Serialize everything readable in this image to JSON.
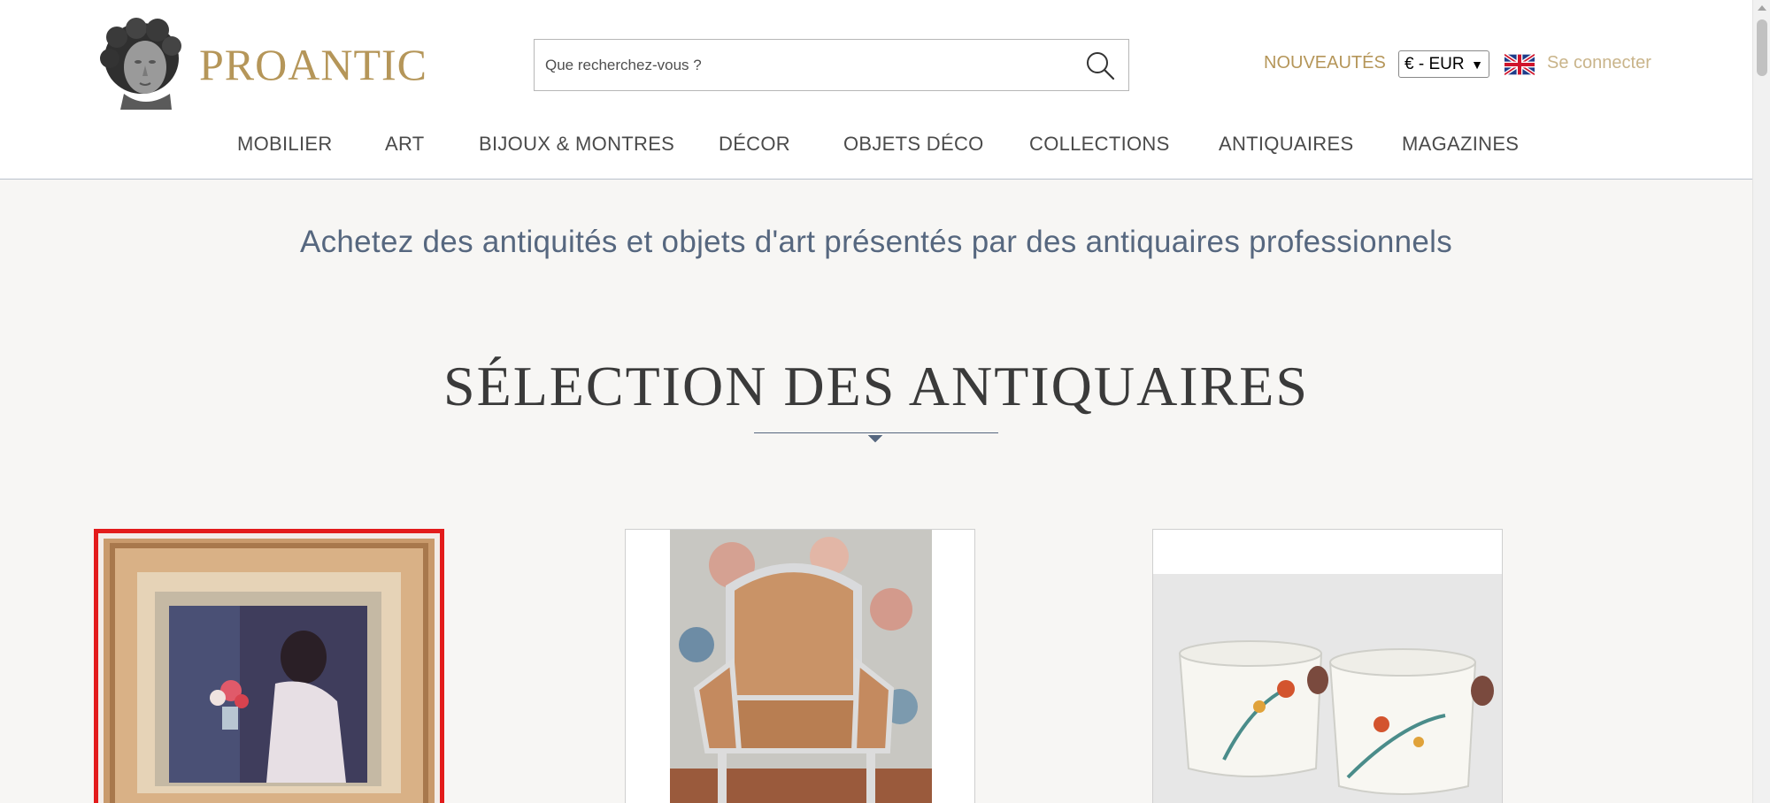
{
  "brand": {
    "name": "PROANTIC",
    "color": "#b59659"
  },
  "search": {
    "placeholder": "Que recherchez-vous ?"
  },
  "header": {
    "new_label": "NOUVEAUTÉS",
    "currency": "€ - EUR",
    "login_label": "Se connecter",
    "language_icon": "uk-flag-icon"
  },
  "nav": {
    "items": [
      {
        "label": "MOBILIER"
      },
      {
        "label": "ART"
      },
      {
        "label": "BIJOUX & MONTRES"
      },
      {
        "label": "DÉCOR"
      },
      {
        "label": "OBJETS DÉCO"
      },
      {
        "label": "COLLECTIONS"
      },
      {
        "label": "ANTIQUAIRES"
      },
      {
        "label": "MAGAZINES"
      }
    ]
  },
  "main": {
    "tagline": "Achetez des antiquités et objets d'art présentés par des antiquaires professionnels",
    "section_title": "SÉLECTION DES ANTIQUAIRES",
    "cards": [
      {
        "image": "framed-painting",
        "selected": true
      },
      {
        "image": "armchair",
        "selected": false
      },
      {
        "image": "porcelain-cache-pots",
        "selected": false
      }
    ]
  },
  "colors": {
    "accent": "#b59659",
    "text_blue": "#56677f",
    "selection": "#e31b1b"
  }
}
